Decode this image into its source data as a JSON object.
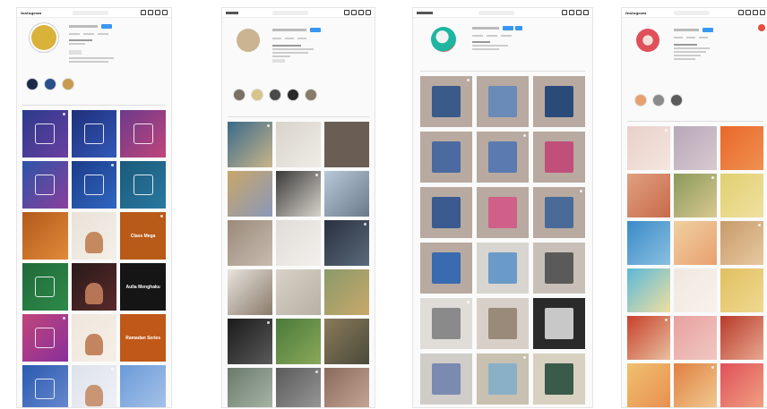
{
  "panels": [
    {
      "id": "p1",
      "app": "Instagram",
      "avatar_color": "#d9b23a",
      "highlights": [
        {
          "color": "#1d2b4a"
        },
        {
          "color": "#2b4f8a"
        },
        {
          "color": "#c89a52"
        }
      ],
      "tiles": [
        {
          "bg": "linear-gradient(135deg,#2a3a8c,#6a3fa0)",
          "kind": "logo"
        },
        {
          "bg": "linear-gradient(135deg,#1e2f7a,#3358b8)",
          "kind": "logo"
        },
        {
          "bg": "linear-gradient(135deg,#6c3a8c,#c0457a)",
          "kind": "logo"
        },
        {
          "bg": "linear-gradient(135deg,#2b55a8,#8a3f9c)",
          "kind": "logo"
        },
        {
          "bg": "linear-gradient(135deg,#1c3a8a,#2f68c0)",
          "kind": "logo"
        },
        {
          "bg": "linear-gradient(135deg,#1a5a7a,#2a78a0)",
          "kind": "logo"
        },
        {
          "bg": "linear-gradient(135deg,#b25a1a,#e08a3a)",
          "kind": "plain"
        },
        {
          "bg": "linear-gradient(135deg,#e8e2d8,#f4efe8)",
          "kind": "face",
          "face": "#c4895f"
        },
        {
          "bg": "#b85a18",
          "kind": "text",
          "text": "Class Mega"
        },
        {
          "bg": "linear-gradient(135deg,#1f6a3a,#2e8a4a)",
          "kind": "logo"
        },
        {
          "bg": "linear-gradient(135deg,#2a1a1a,#5a2a2a)",
          "kind": "face",
          "face": "#b67556"
        },
        {
          "bg": "#151515",
          "kind": "text",
          "text": "Aulia Menghaku"
        },
        {
          "bg": "linear-gradient(135deg,#c0457a,#8a2f9c)",
          "kind": "logo"
        },
        {
          "bg": "linear-gradient(135deg,#efe6dc,#f6efe7)",
          "kind": "face",
          "face": "#c38560"
        },
        {
          "bg": "#c05818",
          "kind": "text",
          "text": "Ramadan Series"
        },
        {
          "bg": "linear-gradient(135deg,#2a5ab0,#6a8ad0)",
          "kind": "logo"
        },
        {
          "bg": "linear-gradient(135deg,#dde2ea,#f0f2f6)",
          "kind": "face",
          "face": "#c89575"
        },
        {
          "bg": "linear-gradient(135deg,#6a9ad8,#a8c4ea)",
          "kind": "plain"
        }
      ]
    },
    {
      "id": "p2",
      "avatar_color": "#c9b590",
      "highlights": [
        {
          "color": "#7a7064"
        },
        {
          "color": "#d8c48a"
        },
        {
          "color": "#4a4a4a"
        },
        {
          "color": "#2a2a2a"
        },
        {
          "color": "#8a7a6a"
        }
      ],
      "tiles": [
        {
          "bg": "linear-gradient(135deg,#3a6a8a,#c9b58a)"
        },
        {
          "bg": "linear-gradient(135deg,#d8d4cc,#efece6)"
        },
        {
          "bg": "#6a5e54"
        },
        {
          "bg": "linear-gradient(135deg,#c9a66a,#8a98b8)"
        },
        {
          "bg": "linear-gradient(135deg,#3a3a3a,#d8d4cc)"
        },
        {
          "bg": "linear-gradient(135deg,#b8c8d8,#6a7a8a)"
        },
        {
          "bg": "linear-gradient(135deg,#9a8a7a,#c8bcb0)"
        },
        {
          "bg": "linear-gradient(135deg,#e0ddd8,#f2f0ec)"
        },
        {
          "bg": "linear-gradient(135deg,#2a3040,#5a6a7a)"
        },
        {
          "bg": "linear-gradient(135deg,#e8e4de,#8a7a6a)"
        },
        {
          "bg": "linear-gradient(135deg,#d8d2c8,#b8b0a4)"
        },
        {
          "bg": "linear-gradient(135deg,#8a9a6a,#c8a86a)"
        },
        {
          "bg": "linear-gradient(135deg,#1a1a1a,#5a5a5a)"
        },
        {
          "bg": "linear-gradient(135deg,#4a7a3a,#8aa85a)"
        },
        {
          "bg": "linear-gradient(135deg,#8a7a5a,#4a4a3a)"
        },
        {
          "bg": "linear-gradient(135deg,#6a7a6a,#aab8a8)"
        },
        {
          "bg": "linear-gradient(135deg,#5a5a5a,#9a9a9a)"
        },
        {
          "bg": "linear-gradient(135deg,#8a6a5a,#c8a898)"
        }
      ]
    },
    {
      "id": "p3",
      "avatar_color": "#1fb5a0",
      "tiles": [
        {
          "bg": "#b8aaa0",
          "inner": "#3a5a8a"
        },
        {
          "bg": "#b8aaa0",
          "inner": "#6a8ab8"
        },
        {
          "bg": "#b8aaa0",
          "inner": "#2a4a7a"
        },
        {
          "bg": "#b8aaa0",
          "inner": "#4a6aa0"
        },
        {
          "bg": "#b8aaa0",
          "inner": "#5a7ab0"
        },
        {
          "bg": "#b8aaa0",
          "inner": "#c0507a"
        },
        {
          "bg": "#b8aaa0",
          "inner": "#3a5a90"
        },
        {
          "bg": "#b8aaa0",
          "inner": "#d0608a"
        },
        {
          "bg": "#b8aaa0",
          "inner": "#4a6a9a"
        },
        {
          "bg": "#b8aaa0",
          "inner": "#3a6ab0"
        },
        {
          "bg": "#d8d4d0",
          "inner": "#6a9ac8"
        },
        {
          "bg": "#c8c0b8",
          "inner": "#5a5a5a"
        },
        {
          "bg": "#e0dcd8",
          "inner": "#8a8a8a"
        },
        {
          "bg": "#d8d0c8",
          "inner": "#9a8a7a"
        },
        {
          "bg": "#2a2a2a",
          "inner": "#c8c8c8"
        },
        {
          "bg": "#d0ccc8",
          "inner": "#7a8ab0"
        },
        {
          "bg": "#c8c0b0",
          "inner": "#8ab0c8"
        },
        {
          "bg": "#d8d0c0",
          "inner": "#3a5a4a"
        }
      ]
    },
    {
      "id": "p4",
      "app": "Instagram",
      "avatar_color": "#e0505a",
      "highlights": [
        {
          "color": "#e8a070"
        },
        {
          "color": "#8a8a8a"
        },
        {
          "color": "#5a5a5a"
        }
      ],
      "tiles": [
        {
          "bg": "linear-gradient(135deg,#e8d0c8,#f4e6e0)"
        },
        {
          "bg": "linear-gradient(135deg,#b8a8b8,#d8c8d0)"
        },
        {
          "bg": "linear-gradient(135deg,#e8682a,#f09050)"
        },
        {
          "bg": "linear-gradient(135deg,#e0a080,#c86a4a)"
        },
        {
          "bg": "linear-gradient(135deg,#8a9a5a,#d8c890)"
        },
        {
          "bg": "linear-gradient(135deg,#e0d070,#f0e0a0)"
        },
        {
          "bg": "linear-gradient(135deg,#3a8ac8,#8ac0e0)"
        },
        {
          "bg": "linear-gradient(135deg,#f0d0a0,#e8a070)"
        },
        {
          "bg": "linear-gradient(135deg,#c89a6a,#e8c8a0)"
        },
        {
          "bg": "linear-gradient(135deg,#5ab8d8,#f0e0a0)"
        },
        {
          "bg": "linear-gradient(135deg,#f0e8e0,#f8f2ec)"
        },
        {
          "bg": "linear-gradient(135deg,#e0c060,#f0d890)"
        },
        {
          "bg": "linear-gradient(135deg,#c8402a,#e8c0a0)"
        },
        {
          "bg": "linear-gradient(135deg,#e8a0a0,#f0c8c0)"
        },
        {
          "bg": "linear-gradient(135deg,#b83a2a,#e8a890)"
        },
        {
          "bg": "linear-gradient(135deg,#f0c070,#e89050)"
        },
        {
          "bg": "linear-gradient(135deg,#e08040,#f0c890)"
        },
        {
          "bg": "linear-gradient(135deg,#e0505a,#f0a080)"
        }
      ]
    }
  ]
}
